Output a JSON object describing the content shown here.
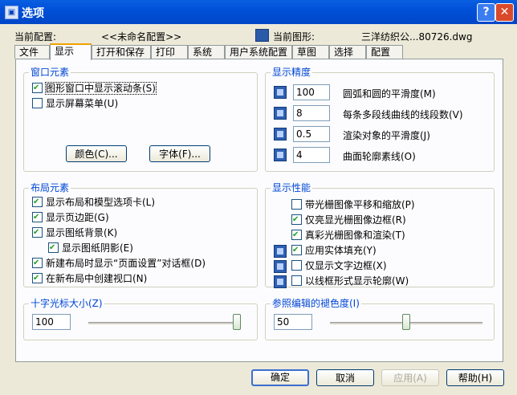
{
  "title": "选项",
  "titlebar": {
    "help": "?",
    "close": "✕"
  },
  "header": {
    "current_profile_label": "当前配置:",
    "current_profile_value": "<<未命名配置>>",
    "current_drawing_label": "当前图形:",
    "current_drawing_value": "三洋纺织公...80726.dwg"
  },
  "tabs": [
    "文件",
    "显示",
    "打开和保存",
    "打印",
    "系统",
    "用户系统配置",
    "草图",
    "选择",
    "配置"
  ],
  "active_tab": "显示",
  "window_elements": {
    "title": "窗口元素",
    "scrollbars": {
      "label": "图形窗口中显示滚动条(S)",
      "checked": true
    },
    "screen_menu": {
      "label": "显示屏幕菜单(U)",
      "checked": false
    },
    "colors_button": "颜色(C)...",
    "fonts_button": "字体(F)..."
  },
  "display_resolution": {
    "title": "显示精度",
    "items": [
      {
        "value": "100",
        "label": "圆弧和圆的平滑度(M)"
      },
      {
        "value": "8",
        "label": "每条多段线曲线的线段数(V)"
      },
      {
        "value": "0.5",
        "label": "渲染对象的平滑度(J)"
      },
      {
        "value": "4",
        "label": "曲面轮廓素线(O)"
      }
    ]
  },
  "layout_elements": {
    "title": "布局元素",
    "items": [
      {
        "label": "显示布局和模型选项卡(L)",
        "checked": true
      },
      {
        "label": "显示页边距(G)",
        "checked": true
      },
      {
        "label": "显示图纸背景(K)",
        "checked": true
      },
      {
        "label": "显示图纸阴影(E)",
        "checked": true
      },
      {
        "label": "新建布局时显示“页面设置”对话框(D)",
        "checked": true
      },
      {
        "label": "在新布局中创建视口(N)",
        "checked": true
      }
    ]
  },
  "display_performance": {
    "title": "显示性能",
    "items": [
      {
        "label": "带光栅图像平移和缩放(P)",
        "checked": false
      },
      {
        "label": "仅亮显光栅图像边框(R)",
        "checked": true
      },
      {
        "label": "真彩光栅图像和渲染(T)",
        "checked": true
      },
      {
        "label": "应用实体填充(Y)",
        "checked": true
      },
      {
        "label": "仅显示文字边框(X)",
        "checked": false
      },
      {
        "label": "以线框形式显示轮廓(W)",
        "checked": false
      }
    ]
  },
  "crosshair": {
    "title": "十字光标大小(Z)",
    "value": "100",
    "level": 1.0
  },
  "xref_fade": {
    "title": "参照编辑的褪色度(I)",
    "value": "50",
    "level": 0.5
  },
  "footer": {
    "ok": "确定",
    "cancel": "取消",
    "apply": "应用(A)",
    "help": "帮助(H)"
  }
}
